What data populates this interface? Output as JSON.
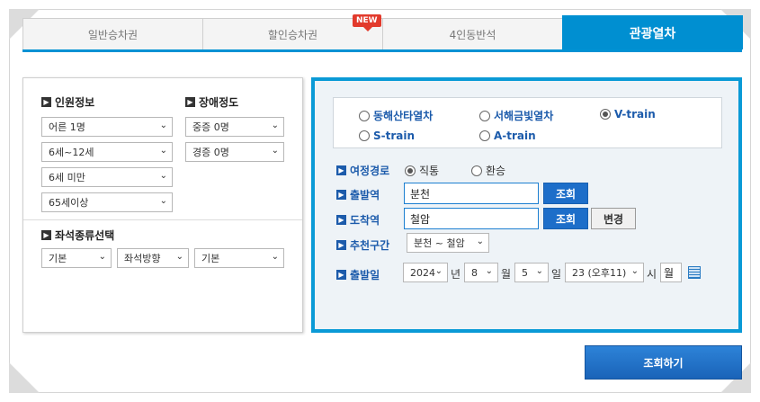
{
  "tabs": [
    {
      "label": "일반승차권",
      "active": false
    },
    {
      "label": "할인승차권",
      "active": false,
      "badge": "NEW"
    },
    {
      "label": "4인동반석",
      "active": false
    },
    {
      "label": "관광열차",
      "active": true
    }
  ],
  "passenger": {
    "title": "인원정보",
    "adult": "어른 1명",
    "child": "6세~12세",
    "infant": "6세 미만",
    "senior": "65세이상"
  },
  "disability": {
    "title": "장애정도",
    "severe": "중증 0명",
    "mild": "경증 0명"
  },
  "seat": {
    "title": "좌석종류선택",
    "type": "기본",
    "direction": "좌석방향",
    "option": "기본"
  },
  "trains": [
    {
      "label": "동해산타열차",
      "selected": false
    },
    {
      "label": "서해금빛열차",
      "selected": false
    },
    {
      "label": "V-train",
      "selected": true
    },
    {
      "label": "S-train",
      "selected": false
    },
    {
      "label": "A-train",
      "selected": false
    }
  ],
  "route": {
    "label": "여정경로",
    "direct": "직통",
    "transfer": "환승",
    "selected": "직통"
  },
  "departure": {
    "label": "출발역",
    "value": "분천",
    "search_btn": "조회"
  },
  "arrival": {
    "label": "도착역",
    "value": "철암",
    "search_btn": "조회",
    "swap_btn": "변경"
  },
  "recommended": {
    "label": "추천구간",
    "value": "분천 ~ 철암"
  },
  "date": {
    "label": "출발일",
    "year": "2024",
    "year_unit": "년",
    "month": "8",
    "month_unit": "월",
    "day": "5",
    "day_unit": "일",
    "hour": "23 (오후11)",
    "hour_unit": "시",
    "weekday": "월",
    "calendar_icon": "calendar-icon"
  },
  "submit": {
    "label": "조회하기"
  },
  "colors": {
    "accent": "#0092d4",
    "link": "#1c5bab",
    "button": "#1d6ec9"
  }
}
